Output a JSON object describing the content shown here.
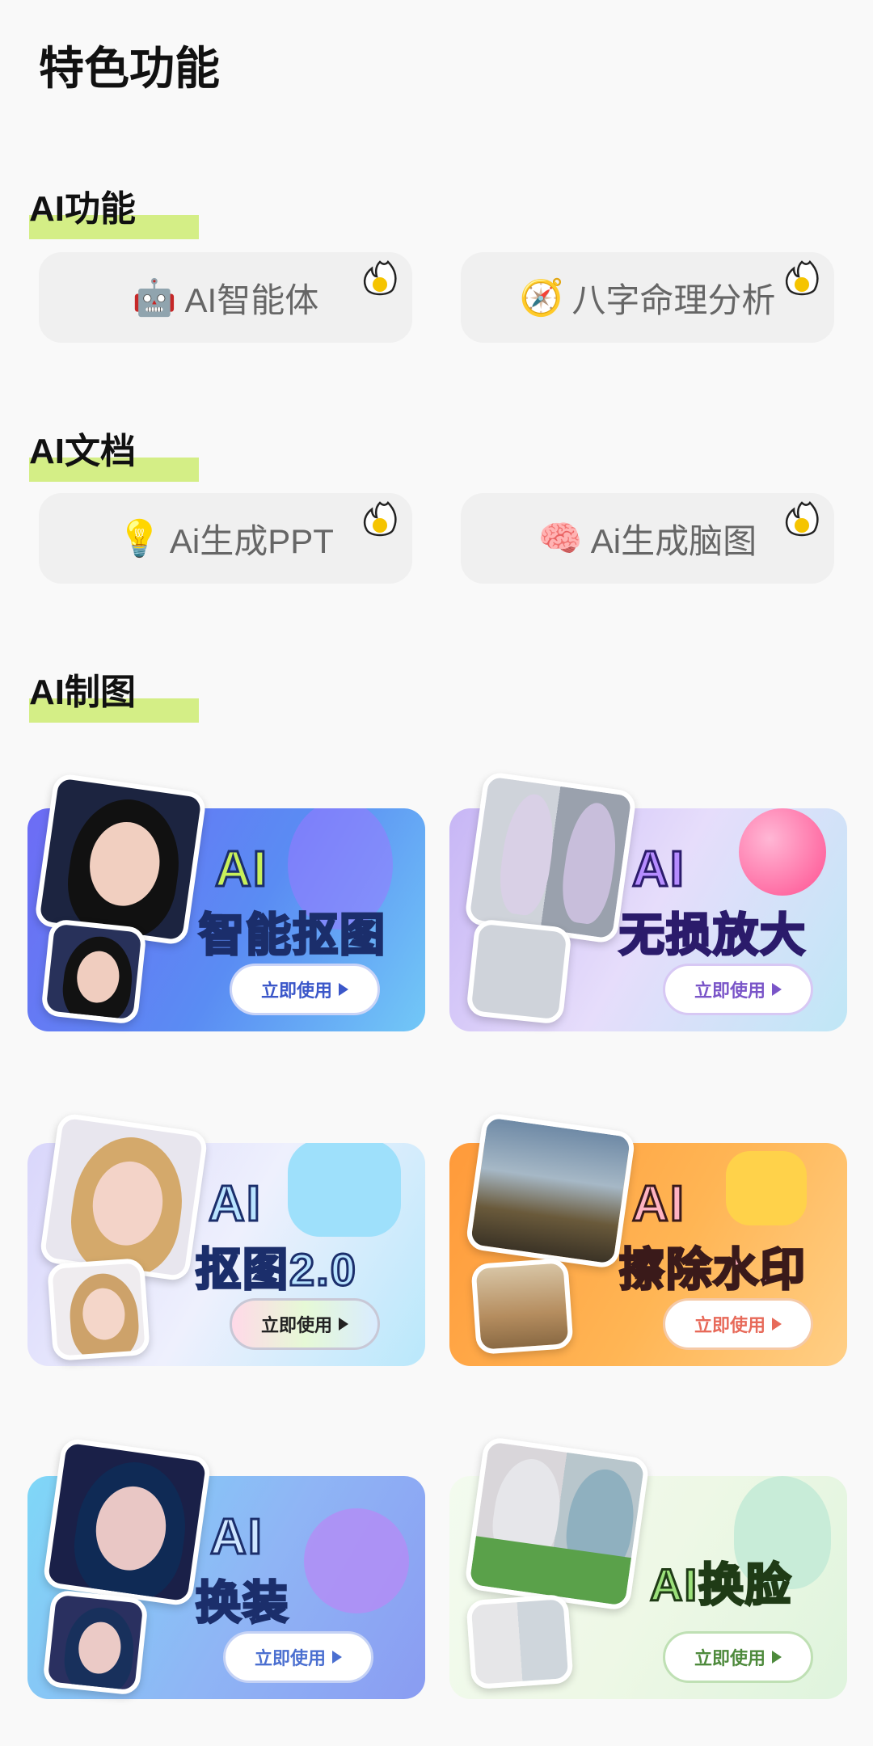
{
  "page": {
    "title": "特色功能"
  },
  "sections": [
    {
      "title": "AI功能"
    },
    {
      "title": "AI文档"
    },
    {
      "title": "AI制图"
    }
  ],
  "ai_features": [
    {
      "emoji": "🤖",
      "label": "AI智能体",
      "icon": "robot-icon"
    },
    {
      "emoji": "🧭",
      "label": "八字命理分析",
      "icon": "compass-icon"
    }
  ],
  "ai_docs": [
    {
      "emoji": "💡",
      "label": "Ai生成PPT",
      "icon": "lightbulb-icon"
    },
    {
      "emoji": "🧠",
      "label": "Ai生成脑图",
      "icon": "brain-icon"
    }
  ],
  "tools": [
    {
      "line1": "AI",
      "line2": "智能抠图",
      "button": "立即使用"
    },
    {
      "line1": "AI",
      "line2": "无损放大",
      "button": "立即使用"
    },
    {
      "line1": "AI",
      "line2": "抠图2.0",
      "button": "立即使用"
    },
    {
      "line1": "AI",
      "line2": "擦除水印",
      "button": "立即使用"
    },
    {
      "line1": "AI",
      "line2": "换装",
      "button": "立即使用"
    },
    {
      "line1": "AI换脸",
      "button": "立即使用"
    }
  ],
  "colors": {
    "accent_bar": "#d4ee86",
    "pill_bg": "#f0f0f0",
    "hot_badge": "#f5c400"
  }
}
